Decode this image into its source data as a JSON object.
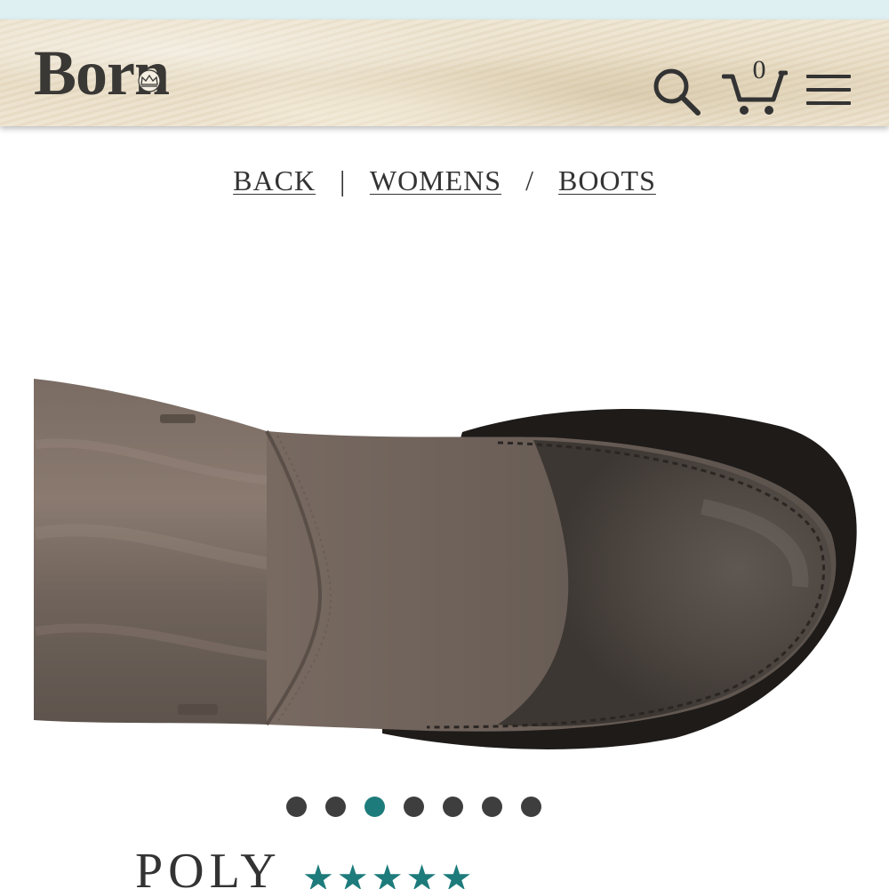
{
  "header": {
    "brand_name": "Born",
    "cart_count": "0",
    "icons": {
      "search": "search-icon",
      "cart": "cart-icon",
      "menu": "hamburger-menu-icon",
      "logo_mark": "crown-icon"
    }
  },
  "breadcrumb": {
    "back": "BACK",
    "separator_primary": "|",
    "category": "WOMENS",
    "separator_secondary": "/",
    "subcategory": "BOOTS"
  },
  "gallery": {
    "total_images": 7,
    "active_index": 2,
    "active_dot_color": "#1e7b7b"
  },
  "product": {
    "name": "POLY",
    "rating": 5,
    "rating_max": 5
  },
  "colors": {
    "accent": "#1e7b7b",
    "text": "#333333",
    "top_strip": "#dff0f3"
  }
}
